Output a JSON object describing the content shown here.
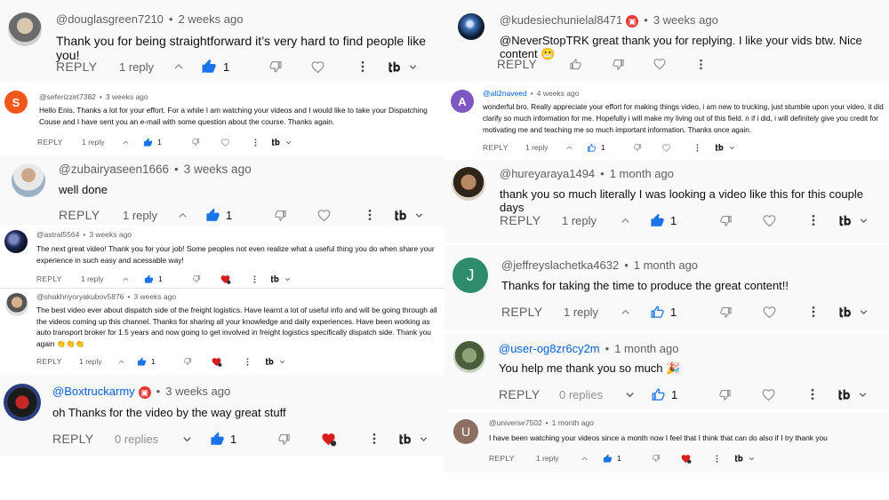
{
  "colors": {
    "like_blue": "#1a73e8",
    "mention_blue": "#065fd4",
    "gray": "#606060",
    "heart_red": "#d81b1b"
  },
  "left": [
    {
      "author": "@douglasgreen7210",
      "time": "2 weeks ago",
      "text": "Thank you for being straightforward it’s very hard to find people like you!",
      "reply_label": "REPLY",
      "replies": "1 reply",
      "likes": "1",
      "avatar_letter": "",
      "avatar_icon": "photo-avatar"
    },
    {
      "author": "@seferizzet7382",
      "time": "3 weeks ago",
      "text": "Hello Enis, Thanks a lot for your effort. For a while I am watching your videos and I would like to take your Dispatching Couse and I have sent you an e-mail with some question about the course. Thanks again.",
      "reply_label": "REPLY",
      "replies": "1 reply",
      "likes": "1",
      "avatar_letter": "S"
    },
    {
      "author": "@zubairyaseen1666",
      "time": "3 weeks ago",
      "text": "well done",
      "reply_label": "REPLY",
      "replies": "1 reply",
      "likes": "1",
      "avatar_letter": ""
    },
    {
      "author": "@astral5564",
      "time": "3 weeks ago",
      "text": "The next great video! Thank you for your job! Some peoples not even realize what a useful thing you do when share your experience in such easy and acessable way!",
      "reply_label": "REPLY",
      "replies": "1 reply",
      "likes": "1",
      "avatar_letter": ""
    },
    {
      "author": "@shakhriyoryakubov5876",
      "time": "3 weeks ago",
      "text": "The best video ever about dispatch side of the freight logistics. Have learnt a lot of useful info and will be going through all the videos coming up this channel. Thanks for sharing all your knowledge and daily experiences. Have been working as auto transport broker for 1.5 years and now going to get involved in freight logistics specifically dispatch side. Thank you again",
      "emoji": "👏👏👏",
      "reply_label": "REPLY",
      "replies": "1 reply",
      "likes": "1",
      "avatar_letter": ""
    },
    {
      "author": "@Boxtruckarmy",
      "time": "3 weeks ago",
      "text": "oh Thanks for the video by the way great stuff",
      "reply_label": "REPLY",
      "replies": "0 replies",
      "likes": "1",
      "avatar_letter": ""
    }
  ],
  "right": [
    {
      "author": "@kudesiechunielal8471",
      "time": "3 weeks ago",
      "text": "@NeverStopTRK  great thank you for replying. I like your vids btw. Nice content",
      "emoji": "😬",
      "reply_label": "REPLY",
      "avatar_letter": ""
    },
    {
      "author": "@ali2naveed",
      "time": "4 weeks ago",
      "text": "wonderful bro, Really appreciate your effort for making things video, i am new to trucking, just stumble upon your video, it did clarify so much information for me. Hopefully i will make my living out of this field. n if i did, i will definitely give you credit for motivating me and teaching me so much important information. Thanks once again.",
      "reply_label": "REPLY",
      "replies": "1 reply",
      "likes": "1",
      "avatar_letter": "A"
    },
    {
      "author": "@hureyaraya1494",
      "time": "1 month ago",
      "text": "thank you so much literally I was looking a video like this for this couple days",
      "reply_label": "REPLY",
      "replies": "1 reply",
      "likes": "1",
      "avatar_letter": ""
    },
    {
      "author": "@jeffreyslachetka4632",
      "time": "1 month ago",
      "text": "Thanks for taking the time to produce the great content!!",
      "reply_label": "REPLY",
      "replies": "1 reply",
      "likes": "1",
      "avatar_letter": "J"
    },
    {
      "author": "@user-og8zr6cy2m",
      "time": "1 month ago",
      "text": "You help me thank you so much",
      "emoji": "🎉",
      "reply_label": "REPLY",
      "replies": "0 replies",
      "likes": "1",
      "avatar_letter": ""
    },
    {
      "author": "@universe7502",
      "time": "1 month ago",
      "text": "I have been watching your videos since a month now I feel that I  think that can do also   if I try thank you",
      "reply_label": "REPLY",
      "replies": "1 reply",
      "likes": "1",
      "avatar_letter": "U"
    }
  ]
}
